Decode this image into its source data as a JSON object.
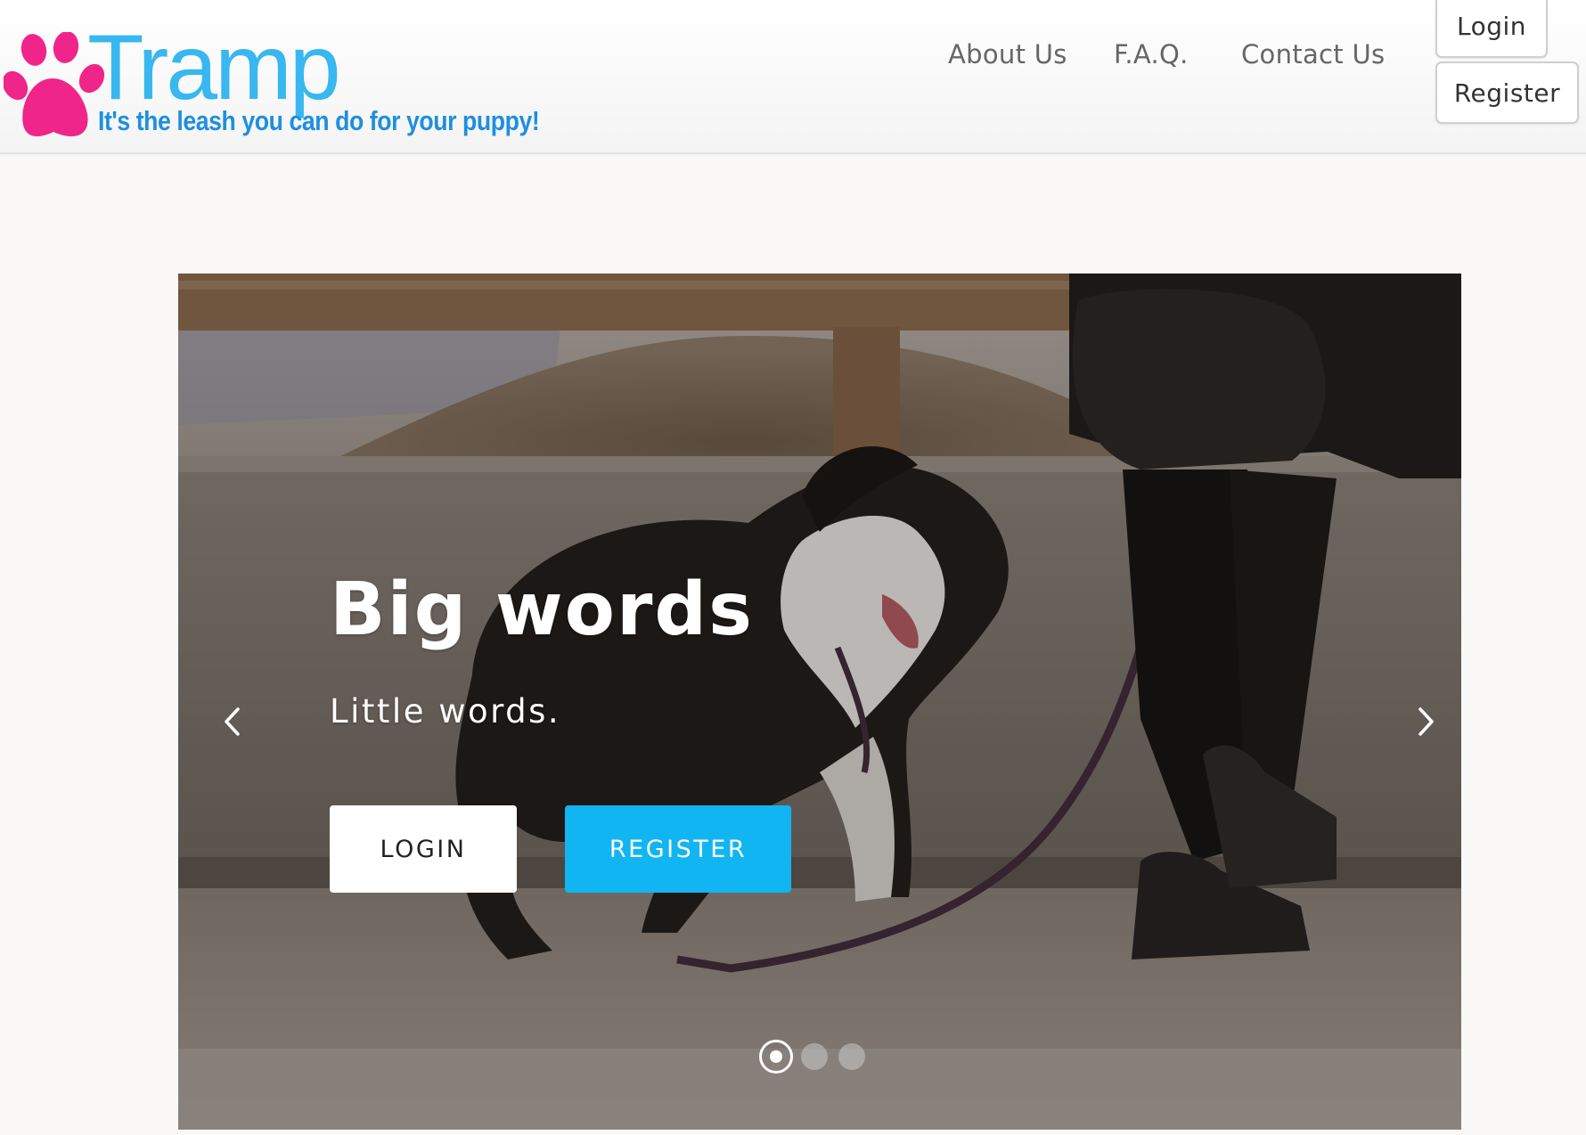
{
  "brand": {
    "name": "Tramp",
    "tagline": "It's the leash you can do for your puppy!",
    "logo_icon": "paw-print-icon",
    "colors": {
      "wordmark": "#38b7f0",
      "tagline": "#1e8fe0",
      "paw": "#f0258a"
    }
  },
  "nav": {
    "items": [
      "About Us",
      "F.A.Q.",
      "Contact Us"
    ]
  },
  "header_actions": {
    "login_label": "Login",
    "register_label": "Register"
  },
  "hero": {
    "image": "dog-on-leash-photo",
    "title": "Big words",
    "subtitle": "Little words.",
    "login_cta": "LOGIN",
    "register_cta": "REGISTER",
    "prev_icon": "chevron-left-icon",
    "next_icon": "chevron-right-icon",
    "carousel": {
      "slides": 3,
      "active": 1
    },
    "colors": {
      "register_cta": "#11b5f2"
    }
  }
}
